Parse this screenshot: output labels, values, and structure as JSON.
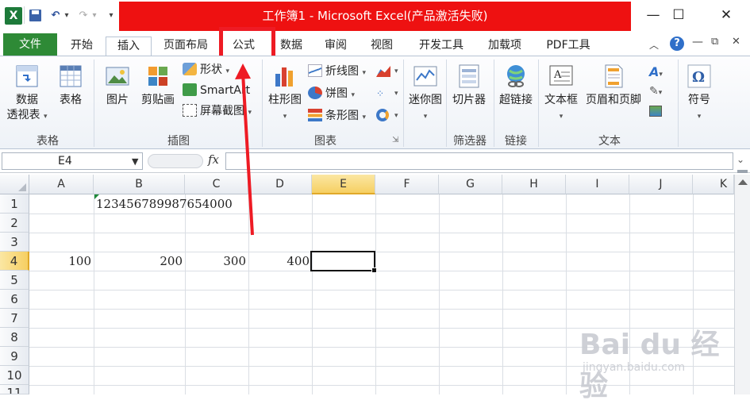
{
  "window": {
    "title": "工作簿1 - Microsoft Excel(产品激活失败)",
    "minimize": "—",
    "maximize": "☐",
    "close": "✕"
  },
  "quick_access": {
    "undo": "↶",
    "redo": "↷",
    "more": "▾"
  },
  "tabs": [
    "文件",
    "开始",
    "插入",
    "页面布局",
    "公式",
    "数据",
    "审阅",
    "视图",
    "开发工具",
    "加载项",
    "PDF工具"
  ],
  "ribbon": {
    "groups": {
      "tables": "表格",
      "illustrations": "插图",
      "charts": "图表",
      "filter": "筛选器",
      "links": "链接",
      "text": "文本"
    },
    "buttons": {
      "pivot_line1": "数据",
      "pivot_line2": "透视表",
      "table": "表格",
      "picture": "图片",
      "clipart": "剪贴画",
      "shapes": "形状",
      "smartart": "SmartArt",
      "screenshot": "屏幕截图",
      "column_chart": "柱形图",
      "line_chart": "折线图",
      "pie_chart": "饼图",
      "bar_chart": "条形图",
      "sparkline": "迷你图",
      "slicer": "切片器",
      "hyperlink": "超链接",
      "textbox": "文本框",
      "header_footer": "页眉和页脚",
      "symbol": "符号"
    }
  },
  "formula_bar": {
    "name_box": "E4",
    "fx": "fx",
    "value": ""
  },
  "columns": [
    "A",
    "B",
    "C",
    "D",
    "E",
    "F",
    "G",
    "H",
    "I",
    "J",
    "K"
  ],
  "rows": [
    "1",
    "2",
    "3",
    "4",
    "5",
    "6",
    "7",
    "8",
    "9",
    "10",
    "11"
  ],
  "cells": {
    "B1": "12345678998765400​0",
    "A4": "100",
    "B4": "200",
    "C4": "300",
    "D4": "400"
  },
  "selected_cell": "E4",
  "watermark": {
    "logo": "Bai du 经验",
    "sub": "jingyan.baidu.com"
  },
  "colors": {
    "title_red": "#ee1111",
    "file_tab": "#2e8a36",
    "highlight": "#ee1b24",
    "selected_header": "#f6cf62"
  }
}
